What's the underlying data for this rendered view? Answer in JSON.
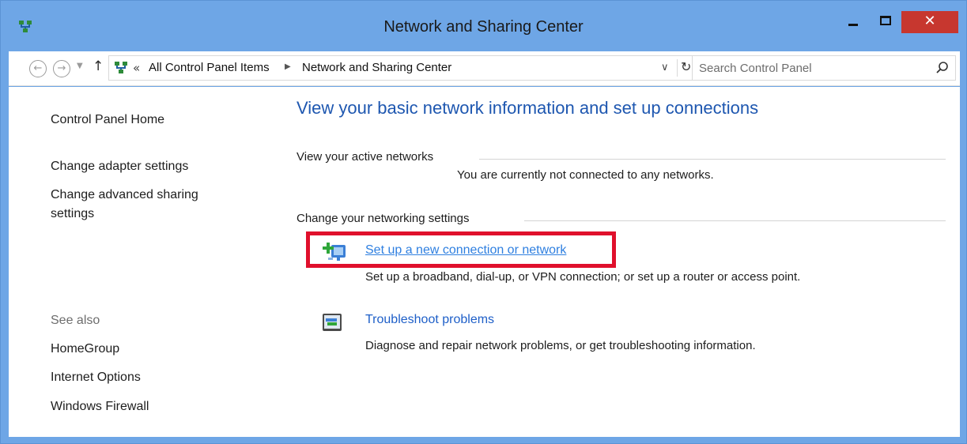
{
  "window": {
    "title": "Network and Sharing Center",
    "close_glyph": "✕"
  },
  "address": {
    "overflow": "«",
    "crumbs": [
      "All Control Panel Items",
      "Network and Sharing Center"
    ],
    "search_placeholder": "Search Control Panel"
  },
  "sidebar": {
    "home": "Control Panel Home",
    "adapter": "Change adapter settings",
    "advanced_line1": "Change advanced sharing",
    "advanced_line2": "settings",
    "see_also": "See also",
    "homegroup": "HomeGroup",
    "internet_options": "Internet Options",
    "firewall": "Windows Firewall"
  },
  "main": {
    "heading": "View your basic network information and set up connections",
    "active_networks_label": "View your active networks",
    "active_networks_status": "You are currently not connected to any networks.",
    "settings_label": "Change your networking settings",
    "tasks": [
      {
        "link": "Set up a new connection or network",
        "desc": "Set up a broadband, dial-up, or VPN connection; or set up a router or access point.",
        "icon": "new-connection-icon"
      },
      {
        "link": "Troubleshoot problems",
        "desc": "Diagnose and repair network problems, or get troubleshooting information.",
        "icon": "troubleshoot-icon"
      }
    ]
  },
  "colors": {
    "titlebar": "#6ea6e6",
    "close": "#c7372f",
    "link": "#1e5fc8",
    "heading": "#1e57b0",
    "highlight": "#e0102c"
  }
}
